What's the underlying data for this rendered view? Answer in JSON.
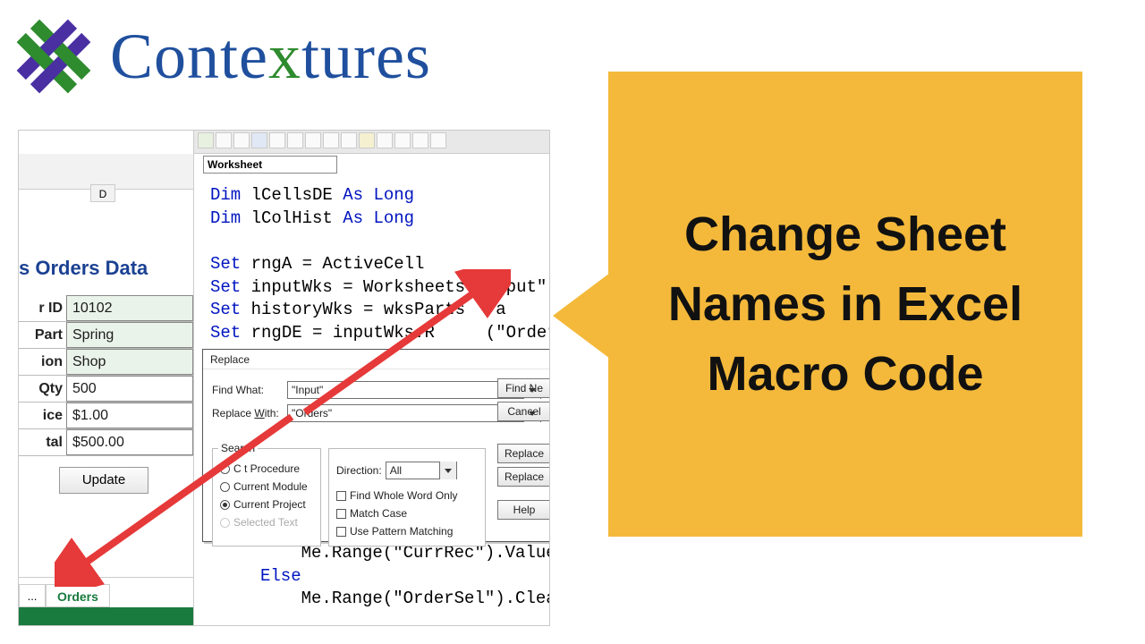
{
  "brand": {
    "name_pre": "Conte",
    "name_x": "x",
    "name_post": "tures"
  },
  "callout": {
    "text": "Change Sheet Names in Excel Macro Code"
  },
  "excel": {
    "col_hdr": "D",
    "title_partial": "s Orders Data",
    "fields": [
      {
        "label": "r ID",
        "value": "10102",
        "plain": false
      },
      {
        "label": "Part",
        "value": "Spring",
        "plain": false
      },
      {
        "label": "ion",
        "value": "Shop",
        "plain": false
      },
      {
        "label": "Qty",
        "value": "500",
        "plain": true
      },
      {
        "label": "ice",
        "value": "$1.00",
        "plain": true
      },
      {
        "label": "tal",
        "value": "$500.00",
        "plain": true
      }
    ],
    "update_btn": "Update",
    "tab_ellipsis": "...",
    "tab_active": "Orders"
  },
  "vbe": {
    "object_dropdown": "Worksheet",
    "code_lines": [
      {
        "pre": "",
        "kw": "Dim",
        "rest": " lCellsDE ",
        "kw2": "As Long",
        "tail": ""
      },
      {
        "pre": "",
        "kw": "Dim",
        "rest": " lColHist ",
        "kw2": "As Long",
        "tail": ""
      },
      {
        "pre": "",
        "kw": "",
        "rest": "",
        "kw2": "",
        "tail": ""
      },
      {
        "pre": "",
        "kw": "Set",
        "rest": " rngA = ActiveCell",
        "kw2": "",
        "tail": ""
      },
      {
        "pre": "",
        "kw": "Set",
        "rest": " inputWks = Worksheets(\"Input\")",
        "kw2": "",
        "tail": ""
      },
      {
        "pre": "",
        "kw": "Set",
        "rest": " historyWks = wksParts   a",
        "kw2": "",
        "tail": ""
      },
      {
        "pre": "",
        "kw": "Set",
        "rest": " rngDE = inputWks.R     (\"OrderE",
        "kw2": "",
        "tail": ""
      }
    ],
    "code_bottom": [
      {
        "pre": "    Me.Range(\"CurrRec\").Value = "
      },
      {
        "kw": "Else"
      },
      {
        "pre": "    Me.Range(\"OrderSel\").ClearCo"
      }
    ]
  },
  "replace": {
    "title": "Replace",
    "find_label": "Find What:",
    "find_value": "\"Input\"",
    "replace_label_pre": "Replace ",
    "replace_label_u": "W",
    "replace_label_post": "ith:",
    "replace_value": "\"Orders\"",
    "search_group": "Search",
    "radios": [
      {
        "label": "C       t Procedure",
        "checked": false,
        "muted": false
      },
      {
        "label": "Current Module",
        "checked": false,
        "muted": false
      },
      {
        "label": "Current Project",
        "checked": true,
        "muted": false
      },
      {
        "label": "Selected Text",
        "checked": false,
        "muted": true
      }
    ],
    "direction_group": "Direction:",
    "direction_value": "All",
    "checks": [
      "Find Whole Word Only",
      "Match Case",
      "Use Pattern Matching"
    ],
    "buttons": {
      "find_next": "Find Ne",
      "cancel": "Cancel",
      "replace": "Replace",
      "replace_all": "Replace",
      "help": "Help"
    }
  }
}
